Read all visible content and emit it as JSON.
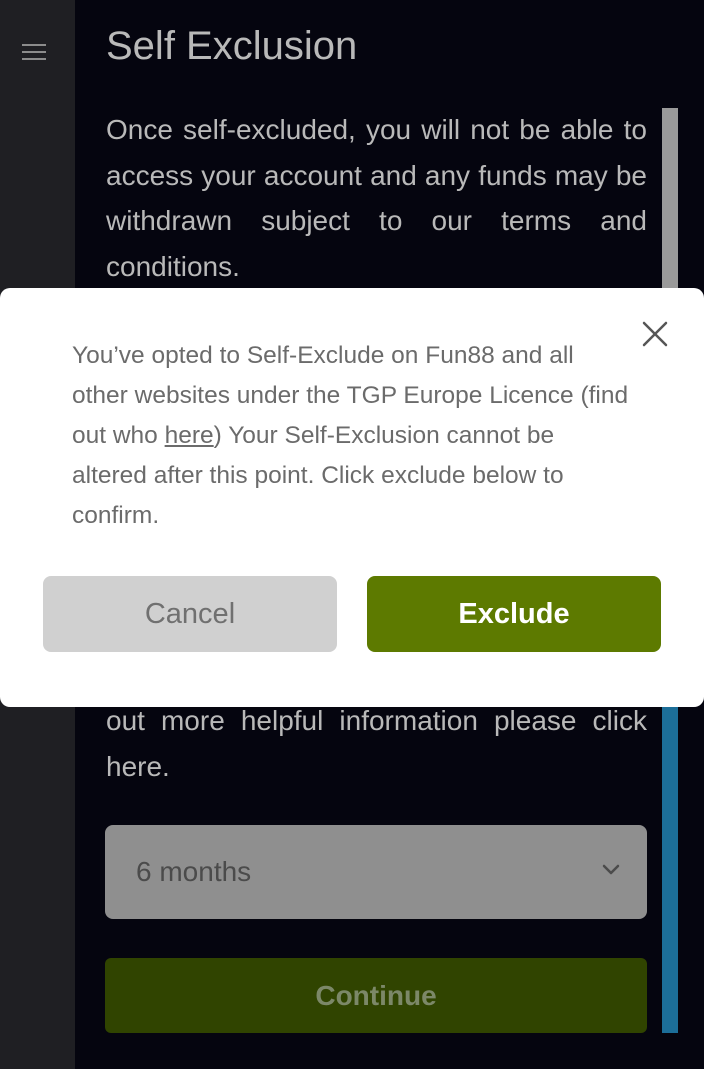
{
  "sidebar": {
    "menu_icon": "hamburger-menu-icon"
  },
  "page": {
    "title": "Self Exclusion",
    "intro_text": "Once self-excluded, you will not be able to access your account and any funds may be withdrawn subject to our terms and conditions.",
    "more_info_text": "out more helpful information please click here."
  },
  "duration_select": {
    "selected_value": "6 months",
    "icon": "chevron-down-icon"
  },
  "continue_button": {
    "label": "Continue"
  },
  "modal": {
    "message_before_link": "You’ve opted to Self-Exclude on Fun88 and all other websites under the TGP Europe Licence (find out who ",
    "link_text": "here",
    "message_after_link": ") Your Self-Exclusion cannot be altered after this point. Click exclude below to confirm.",
    "close_icon": "close-icon",
    "cancel_label": "Cancel",
    "exclude_label": "Exclude"
  },
  "colors": {
    "background": "#05050f",
    "sidebar": "#1f1f23",
    "accent_green": "#5d7a00",
    "continue_green": "#304400",
    "scrollbar_blue": "#1c6e98"
  }
}
